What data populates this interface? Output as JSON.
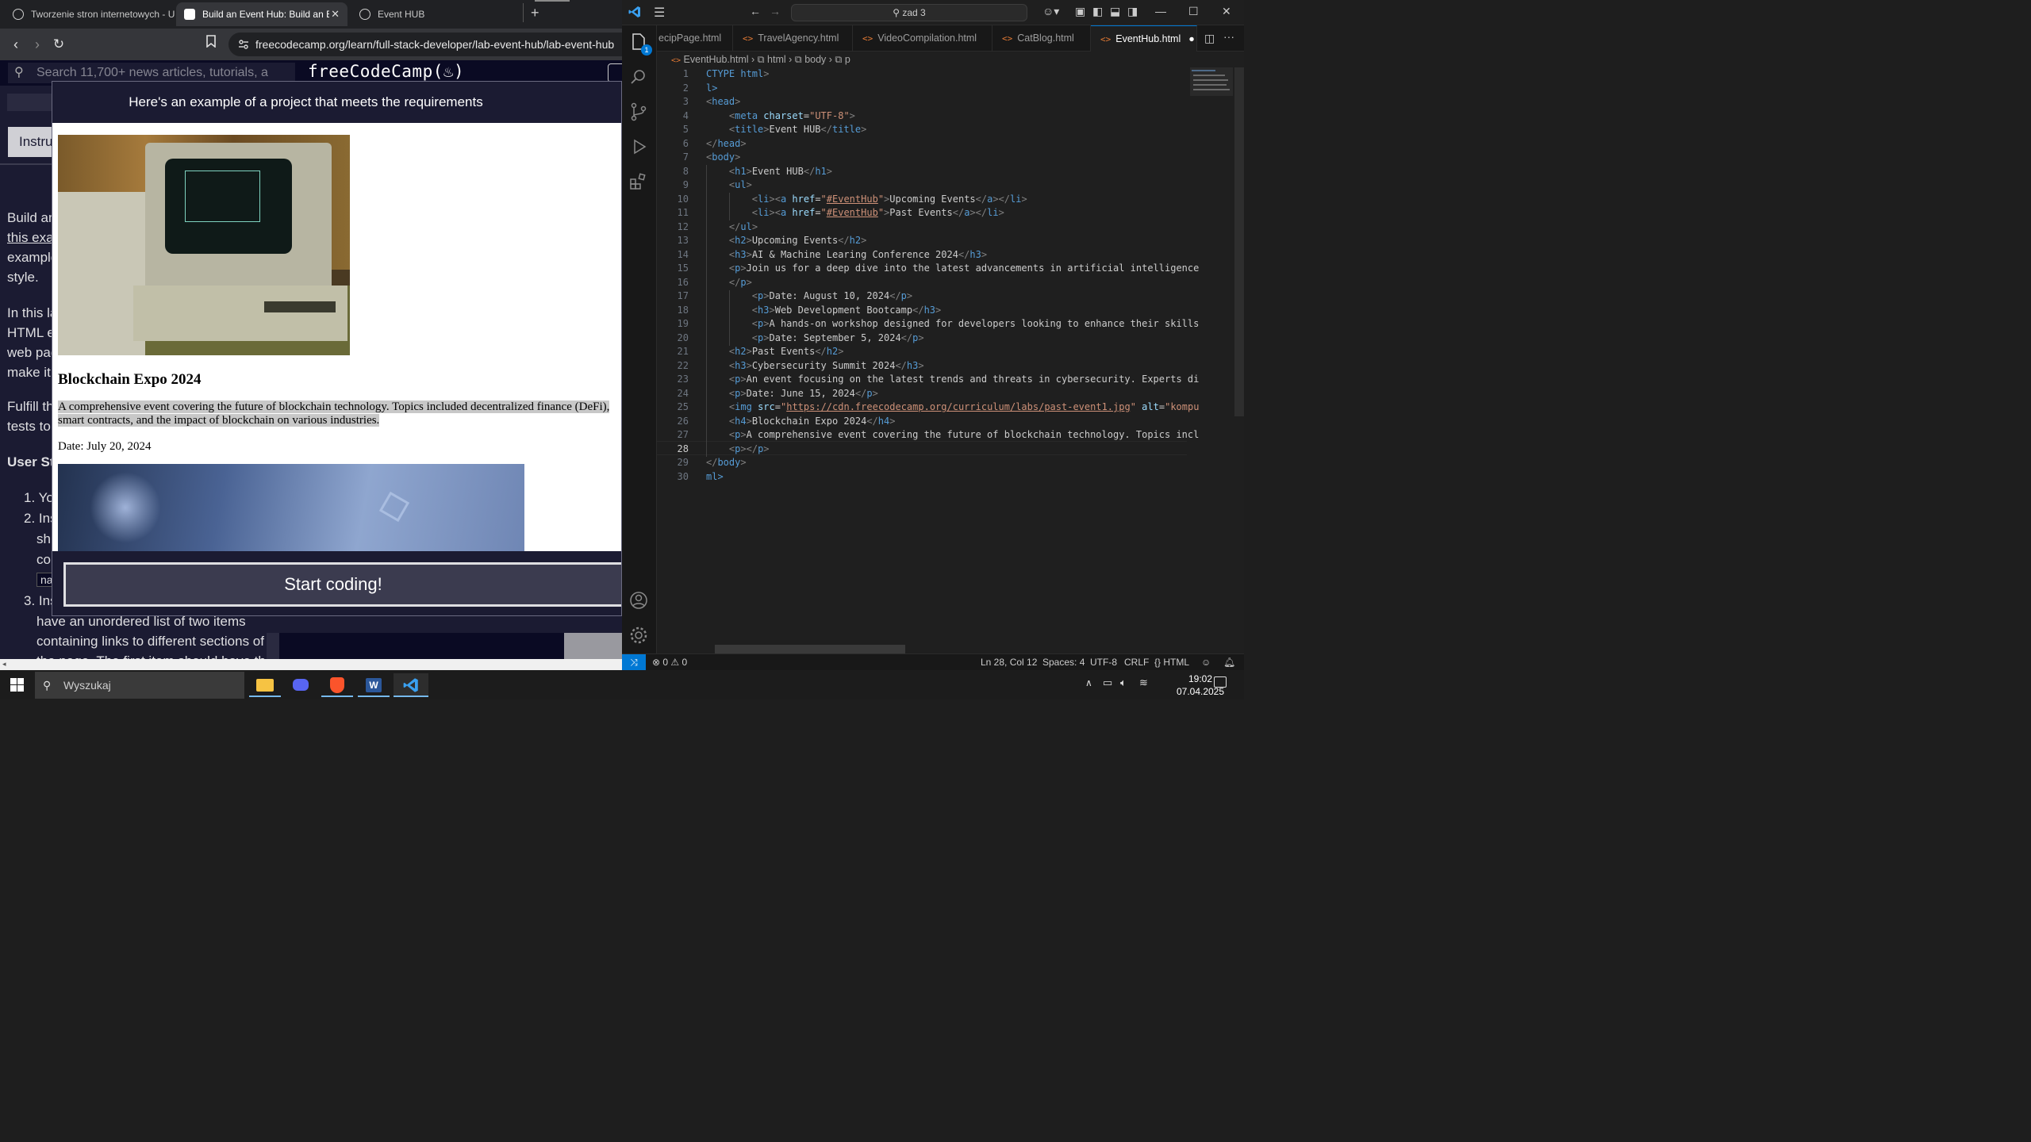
{
  "browser": {
    "tabs": [
      {
        "label": "Tworzenie stron internetowych - Un"
      },
      {
        "label": "Build an Event Hub: Build an Ev"
      },
      {
        "label": "Event HUB"
      }
    ],
    "url": "freecodecamp.org/learn/full-stack-developer/lab-event-hub/lab-event-hub",
    "fcc": {
      "search_placeholder": "Search 11,700+ news articles, tutorials, a",
      "logo": "freeCodeCamp(♨)",
      "instructions_tab": "Instru",
      "bg_lines": [
        "Build an",
        "this exa",
        "example",
        "style.",
        "In this la",
        "HTML e",
        "web pag",
        "make it",
        "Fulfill th",
        "tests to",
        "User Sto"
      ],
      "list_items": [
        "1. Yo",
        "2. Ins",
        "sh",
        "co",
        "na",
        "3. Ins",
        "have an unordered list of two items",
        "containing links to different sections of",
        "the page. The first item should have the"
      ]
    },
    "modal": {
      "header": "Here's an example of a project that meets the requirements",
      "heading": "Blockchain Expo 2024",
      "paragraph": "A comprehensive event covering the future of blockchain technology. Topics included decentralized finance (DeFi), smart contracts, and the impact of blockchain on various industries.",
      "date": "Date: July 20, 2024",
      "start_button": "Start coding!"
    }
  },
  "vscode": {
    "search": "zad 3",
    "tabs": [
      "ecipPage.html",
      "TravelAgency.html",
      "VideoCompilation.html",
      "CatBlog.html",
      "EventHub.html"
    ],
    "breadcrumb": [
      "EventHub.html",
      "html",
      "body",
      "p"
    ],
    "line_numbers": [
      "1",
      "2",
      "3",
      "4",
      "5",
      "6",
      "7",
      "8",
      "9",
      "10",
      "11",
      "12",
      "13",
      "14",
      "15",
      "16",
      "17",
      "18",
      "19",
      "20",
      "21",
      "22",
      "23",
      "24",
      "25",
      "26",
      "27",
      "28",
      "29",
      "30"
    ],
    "current_line": "28",
    "code": {
      "l1a": "CTYPE ",
      "l1b": "html",
      "l1c": ">",
      "l2": "l>",
      "title_text": "Event HUB",
      "h1_text": "Event HUB",
      "anchor_href": "#EventHub",
      "link1": "Upcoming Events",
      "link2": "Past Events",
      "h2a": "Upcoming Events",
      "h3a": "AI & Machine Learing Conference 2024",
      "p15": "Join us for a deep dive into the latest advancements in artificial intelligence",
      "p17": "Date: August 10, 2024",
      "h3b": "Web Development Bootcamp",
      "p19": "A hands-on workshop designed for developers looking to enhance their skills",
      "p20": "Date: September 5, 2024",
      "h2b": "Past Events",
      "h3c": "Cybersecurity Summit 2024",
      "p23": "An event focusing on the latest trends and threats in cybersecurity. Experts di",
      "p24": "Date: June 15, 2024",
      "img_src": "https://cdn.freecodecamp.org/curriculum/labs/past-event1.jpg",
      "img_alt": "kompu",
      "h4": "Blockchain Expo 2024",
      "p27": "A comprehensive event covering the future of blockchain technology. Topics incl",
      "l30": "ml>"
    },
    "status": {
      "problems": "0",
      "warnings": "0",
      "position": "Ln 28, Col 12",
      "spaces": "Spaces: 4",
      "encoding": "UTF-8",
      "eol": "CRLF",
      "language": "HTML"
    },
    "explorer_badge": "1"
  },
  "taskbar": {
    "search": "Wyszukaj",
    "time": "19:02",
    "date": "07.04.2025"
  }
}
